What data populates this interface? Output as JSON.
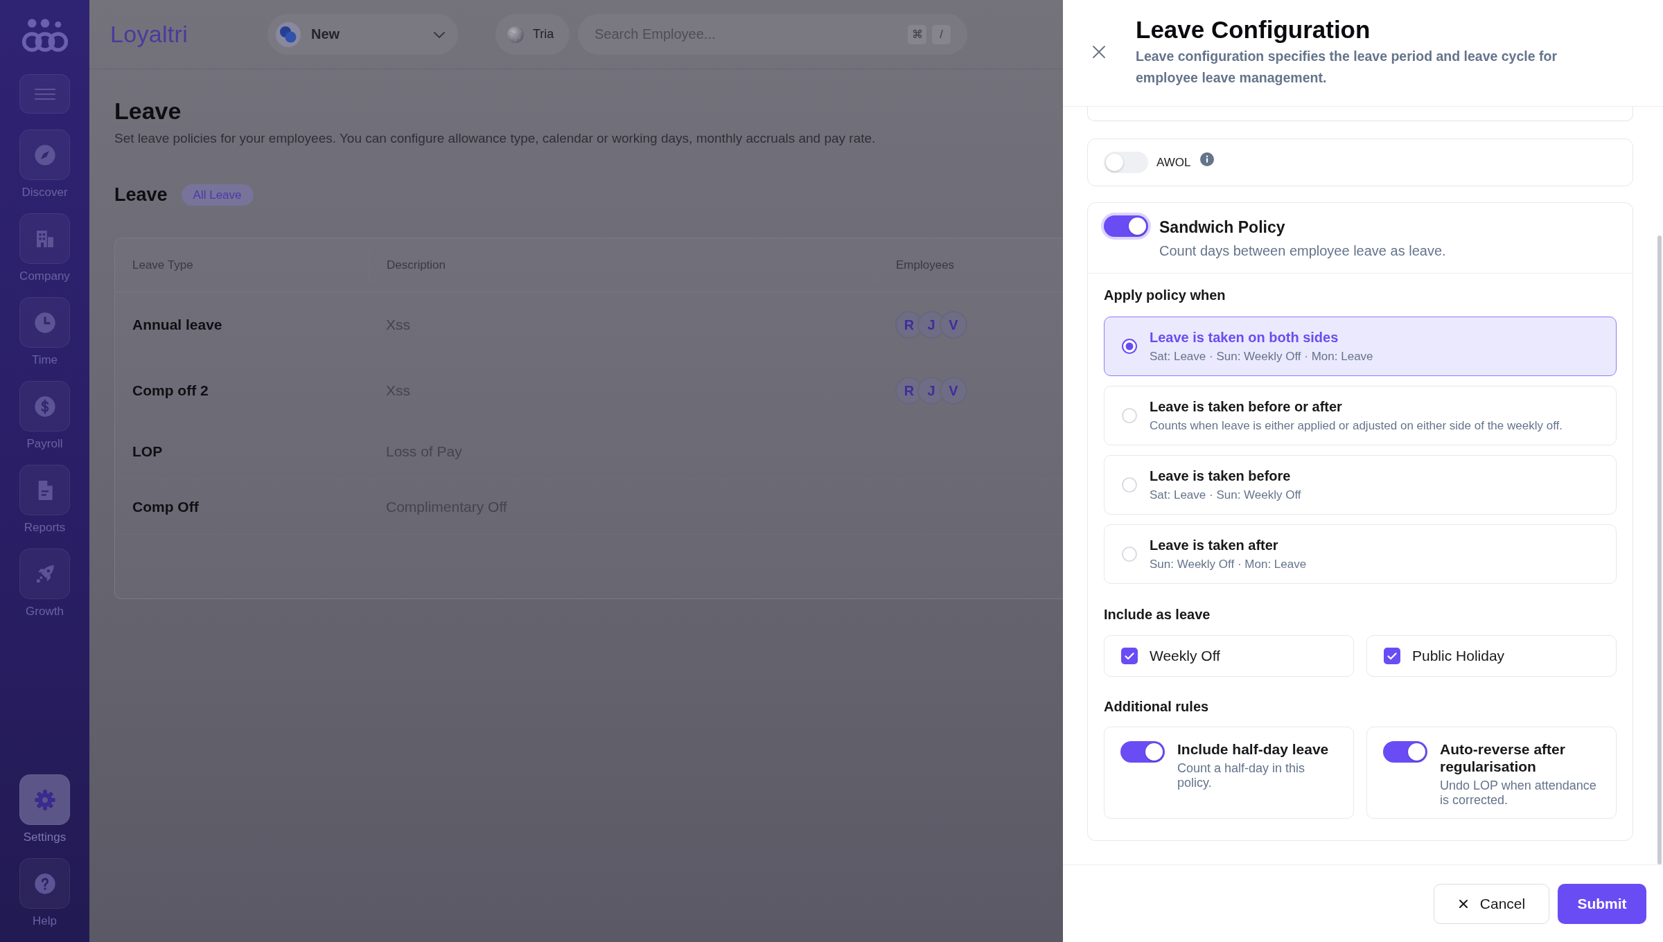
{
  "sidebar": {
    "items": [
      {
        "label": "Discover",
        "selected": false
      },
      {
        "label": "Company",
        "selected": false
      },
      {
        "label": "Time",
        "selected": false
      },
      {
        "label": "Payroll",
        "selected": false
      },
      {
        "label": "Reports",
        "selected": false
      },
      {
        "label": "Growth",
        "selected": false
      }
    ],
    "bottom_items": [
      {
        "label": "Settings",
        "selected": true
      },
      {
        "label": "Help",
        "selected": false
      }
    ]
  },
  "top_bar": {
    "logo": "Loyaltri",
    "workspace_select": {
      "value": "New"
    },
    "user_chip": {
      "label": "Tria"
    },
    "search": {
      "placeholder": "Search Employee...",
      "shortcut_keys": [
        "⌘",
        "/"
      ]
    }
  },
  "page": {
    "title": "Leave",
    "description": "Set leave policies for your employees. You can configure allowance type, calendar or working days, monthly accruals and pay rate.",
    "section": {
      "title": "Leave",
      "badge": "All Leave"
    },
    "table": {
      "columns": [
        "Leave Type",
        "Description",
        "Employees"
      ],
      "rows": [
        {
          "leave_type": "Annual leave",
          "description": "Xss",
          "employees": [
            "R",
            "J",
            "V"
          ]
        },
        {
          "leave_type": "Comp off 2",
          "description": "Xss",
          "employees": [
            "R",
            "J",
            "V"
          ]
        },
        {
          "leave_type": "LOP",
          "description": "Loss of Pay"
        },
        {
          "leave_type": "Comp Off",
          "description": "Complimentary Off"
        }
      ]
    }
  },
  "drawer": {
    "title": "Leave Configuration",
    "description": "Leave configuration specifies the leave period and leave cycle for employee leave management.",
    "awol": {
      "label": "AWOL",
      "on": false
    },
    "sandwich_policy": {
      "title": "Sandwich Policy",
      "description": "Count days between employee leave as leave.",
      "on": true,
      "focused": true,
      "apply_heading": "Apply policy when",
      "options": [
        {
          "title": "Leave is taken on both sides",
          "description": "Sat: Leave · Sun: Weekly Off · Mon: Leave",
          "selected": true
        },
        {
          "title": "Leave is taken before or after",
          "description": "Counts when leave is either applied or adjusted on either side of the weekly off.",
          "selected": false
        },
        {
          "title": "Leave is taken before",
          "description": "Sat: Leave · Sun: Weekly Off",
          "selected": false
        },
        {
          "title": "Leave is taken after",
          "description": "Sun: Weekly Off · Mon: Leave",
          "selected": false
        }
      ],
      "include_heading": "Include as leave",
      "include_options": [
        {
          "label": "Weekly Off",
          "checked": true
        },
        {
          "label": "Public Holiday",
          "checked": true
        }
      ],
      "rules_heading": "Additional rules",
      "rules": [
        {
          "title": "Include half-day leave",
          "description": "Count a half-day in this policy.",
          "on": true
        },
        {
          "title": "Auto-reverse after regularisation",
          "description": "Undo LOP when attendance is corrected.",
          "on": true
        }
      ]
    },
    "buttons": {
      "cancel": "Cancel",
      "submit": "Submit"
    }
  }
}
